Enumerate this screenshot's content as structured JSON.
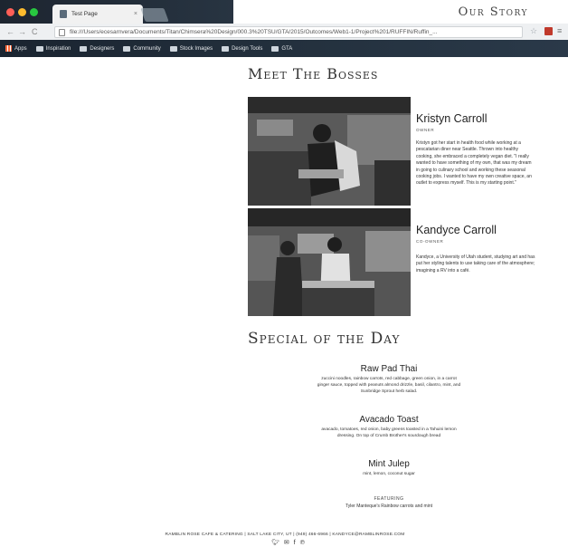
{
  "browser": {
    "tab_title": "Test Page",
    "tab_close": "×",
    "nav": {
      "back": "←",
      "forward": "→",
      "reload": "C"
    },
    "address": "file:///Users/ecesarnvera/Documents/Titan/Chimsera%20Design/000.3%20TSU/GTA/2015/Outcomes/Web1-1/Project%201/RUFFIN/Ruffin_...",
    "bookmarks": [
      "Apps",
      "Inspiration",
      "Designers",
      "Community",
      "Stock Images",
      "Design Tools",
      "GTA"
    ]
  },
  "header": {
    "our_story": "Our Story"
  },
  "bosses": {
    "title": "Meet The Bosses",
    "people": [
      {
        "name": "Kristyn Carroll",
        "role": "OWNER",
        "bio": "Kristyn got her start in health food while working at a pescatarian diner near Seattle. Thrown into healthy cooking, she embraced a completely vegan diet. \"I really wanted to have something of my own, that was my dream in going to culinary school and working these seasonal cooking jobs. I wanted to have my own creative space, an outlet to express myself. This is my starting point.\""
      },
      {
        "name": "Kandyce Carroll",
        "role": "CO-OWNER",
        "bio": "Kandyce, a University of Utah student, studying art and has put her styling talents to use taking care of the atmosphere; imagining a RV into a café."
      }
    ]
  },
  "special": {
    "title": "Special of the Day",
    "items": [
      {
        "name": "Raw Pad Thai",
        "desc": "zuccini noodles, rainbow carrots, red cabbage, green onion, in a carrot ginger sauce, topped with peanuts almond drizzle, basil, cilantro, mint, and Sunbridge Sprout herb salad."
      },
      {
        "name": "Avacado Toast",
        "desc": "avacado, tomatoes, red onion, baby greens toasted in a Tahuini lemon dressing. On top of Crumb Brother's sourdough bread"
      },
      {
        "name": "Mint Julep",
        "desc": "mint, lemon, coconut sugar"
      }
    ],
    "featuring_label": "FEATURING",
    "featuring_text": "Tyler Manteque's Rainbow carrots and mint"
  },
  "footer": {
    "text": "RAMBLIN ROSE CAFE & CATERING | SALT LAKE CITY, UT | (949) 466-6966 | KANDYCE@RAMBLINROSE.COM",
    "social": [
      "twitter-icon",
      "email-icon",
      "facebook-icon",
      "pinterest-icon"
    ]
  },
  "colors": {
    "tab_red": "#ff5f57",
    "tab_yellow": "#febc2e",
    "tab_green": "#28c840",
    "chrome_dark": "#1e2a35"
  }
}
